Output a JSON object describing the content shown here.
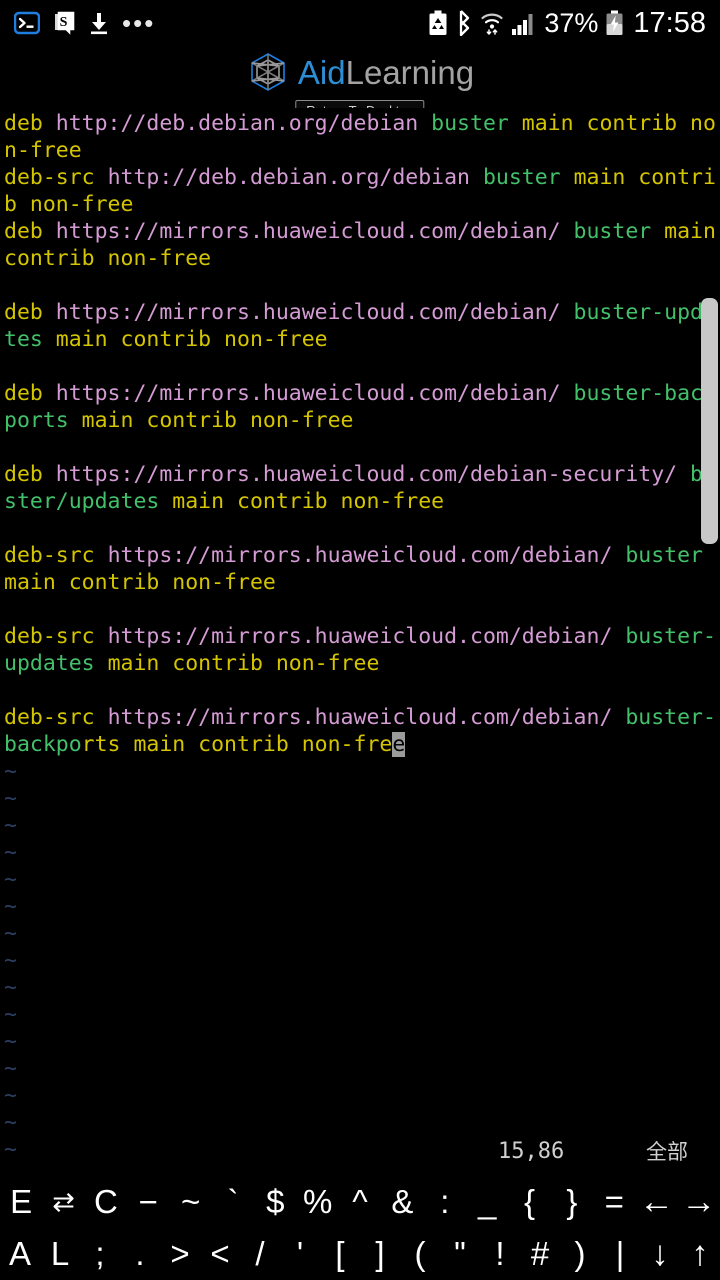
{
  "status_bar": {
    "left_icons": [
      {
        "name": "terminal-icon",
        "glyph": ">_"
      },
      {
        "name": "note-app-icon",
        "glyph": "S"
      },
      {
        "name": "download-icon",
        "glyph": "download"
      },
      {
        "name": "more-notifications-icon",
        "glyph": "•••"
      }
    ],
    "right_icons": [
      {
        "name": "battery-saver-icon",
        "glyph": "battery-saver"
      },
      {
        "name": "bluetooth-icon",
        "glyph": "bluetooth"
      },
      {
        "name": "wifi-icon",
        "glyph": "wifi"
      },
      {
        "name": "cellular-signal-icon",
        "glyph": "signal"
      }
    ],
    "battery_percent": "37%",
    "clock": "17:58"
  },
  "app_header": {
    "logo_primary": "Aid",
    "logo_secondary": "Learning",
    "return_button": "Return To Desktop"
  },
  "terminal": {
    "lines": [
      [
        {
          "t": "deb ",
          "c": "c-kw"
        },
        {
          "t": "http://deb.debian.org/debian ",
          "c": "c-url"
        },
        {
          "t": "buster ",
          "c": "c-dist"
        },
        {
          "t": "main contrib non-free",
          "c": "c-comp"
        }
      ],
      [
        {
          "t": "deb-src ",
          "c": "c-kw"
        },
        {
          "t": "http://deb.debian.org/debian ",
          "c": "c-url"
        },
        {
          "t": "buster ",
          "c": "c-dist"
        },
        {
          "t": "main contrib non-free",
          "c": "c-comp"
        }
      ],
      [
        {
          "t": "deb ",
          "c": "c-kw"
        },
        {
          "t": "https://mirrors.huaweicloud.com/debian/ ",
          "c": "c-url"
        },
        {
          "t": "buster ",
          "c": "c-dist"
        },
        {
          "t": "main contrib non-free",
          "c": "c-comp"
        }
      ],
      [],
      [
        {
          "t": "deb ",
          "c": "c-kw"
        },
        {
          "t": "https://mirrors.huaweicloud.com/debian/ ",
          "c": "c-url"
        },
        {
          "t": "buster-updates ",
          "c": "c-dist"
        },
        {
          "t": "main contrib non-free",
          "c": "c-comp"
        }
      ],
      [],
      [
        {
          "t": "deb ",
          "c": "c-kw"
        },
        {
          "t": "https://mirrors.huaweicloud.com/debian/ ",
          "c": "c-url"
        },
        {
          "t": "buster-backports ",
          "c": "c-dist"
        },
        {
          "t": "main contrib non-free",
          "c": "c-comp"
        }
      ],
      [],
      [
        {
          "t": "deb ",
          "c": "c-kw"
        },
        {
          "t": "https://mirrors.huaweicloud.com/debian-security/ ",
          "c": "c-url"
        },
        {
          "t": "buster/updates ",
          "c": "c-dist"
        },
        {
          "t": "main contrib non-free",
          "c": "c-comp"
        }
      ],
      [],
      [
        {
          "t": "deb-src ",
          "c": "c-kw"
        },
        {
          "t": "https://mirrors.huaweicloud.com/debian/ ",
          "c": "c-url"
        },
        {
          "t": "buster ",
          "c": "c-dist"
        },
        {
          "t": "main contrib non-free",
          "c": "c-comp"
        }
      ],
      [],
      [
        {
          "t": "deb-src ",
          "c": "c-kw"
        },
        {
          "t": "https://mirrors.huaweicloud.com/debian/ ",
          "c": "c-url"
        },
        {
          "t": "buster-updates ",
          "c": "c-dist"
        },
        {
          "t": "main contrib non-free",
          "c": "c-comp"
        }
      ],
      [],
      [
        {
          "t": "deb-src ",
          "c": "c-kw"
        },
        {
          "t": "https://mirrors.huaweicloud.com/debian/ ",
          "c": "c-url"
        },
        {
          "t": "buster-backpo",
          "c": "c-dist"
        },
        {
          "t": "rts main contrib non-fre",
          "c": "c-comp"
        },
        {
          "t": "e",
          "c": "c-comp cursor-blk"
        }
      ]
    ],
    "empty_marker": "~",
    "empty_marker_count": 15,
    "status_position": "15,86",
    "status_percent": "全部"
  },
  "keybar": {
    "row1": [
      {
        "label": "E",
        "name": "key-esc"
      },
      {
        "label": "⇄",
        "name": "key-tab"
      },
      {
        "label": "C",
        "name": "key-ctrl"
      },
      {
        "label": "−",
        "name": "key-minus"
      },
      {
        "label": "~",
        "name": "key-tilde"
      },
      {
        "label": "`",
        "name": "key-backtick"
      },
      {
        "label": "$",
        "name": "key-dollar"
      },
      {
        "label": "%",
        "name": "key-percent"
      },
      {
        "label": "^",
        "name": "key-caret"
      },
      {
        "label": "&",
        "name": "key-ampersand"
      },
      {
        "label": ":",
        "name": "key-colon"
      },
      {
        "label": "_",
        "name": "key-underscore"
      },
      {
        "label": "{",
        "name": "key-brace-open"
      },
      {
        "label": "}",
        "name": "key-brace-close"
      },
      {
        "label": "=",
        "name": "key-equals"
      },
      {
        "label": "←",
        "name": "key-arrow-left"
      },
      {
        "label": "→",
        "name": "key-arrow-right"
      }
    ],
    "row2": [
      {
        "label": "A",
        "name": "key-alt"
      },
      {
        "label": "L",
        "name": "key-l"
      },
      {
        "label": ";",
        "name": "key-semicolon"
      },
      {
        "label": ".",
        "name": "key-period"
      },
      {
        "label": ">",
        "name": "key-greater-than"
      },
      {
        "label": "<",
        "name": "key-less-than"
      },
      {
        "label": "/",
        "name": "key-slash"
      },
      {
        "label": "'",
        "name": "key-apostrophe"
      },
      {
        "label": "[",
        "name": "key-bracket-open"
      },
      {
        "label": "]",
        "name": "key-bracket-close"
      },
      {
        "label": "(",
        "name": "key-paren-open"
      },
      {
        "label": "\"",
        "name": "key-quote"
      },
      {
        "label": "!",
        "name": "key-exclamation"
      },
      {
        "label": "#",
        "name": "key-hash"
      },
      {
        "label": ")",
        "name": "key-paren-close"
      },
      {
        "label": "|",
        "name": "key-pipe"
      },
      {
        "label": "↓",
        "name": "key-arrow-down"
      },
      {
        "label": "↑",
        "name": "key-arrow-up"
      }
    ]
  },
  "colors": {
    "background": "#000000",
    "keyword": "#d4c500",
    "url": "#d49bd4",
    "distribution": "#43c06a",
    "tilde": "#2c3f63",
    "cursor": "#9b9b9b",
    "accent_blue": "#2b8fd6"
  }
}
